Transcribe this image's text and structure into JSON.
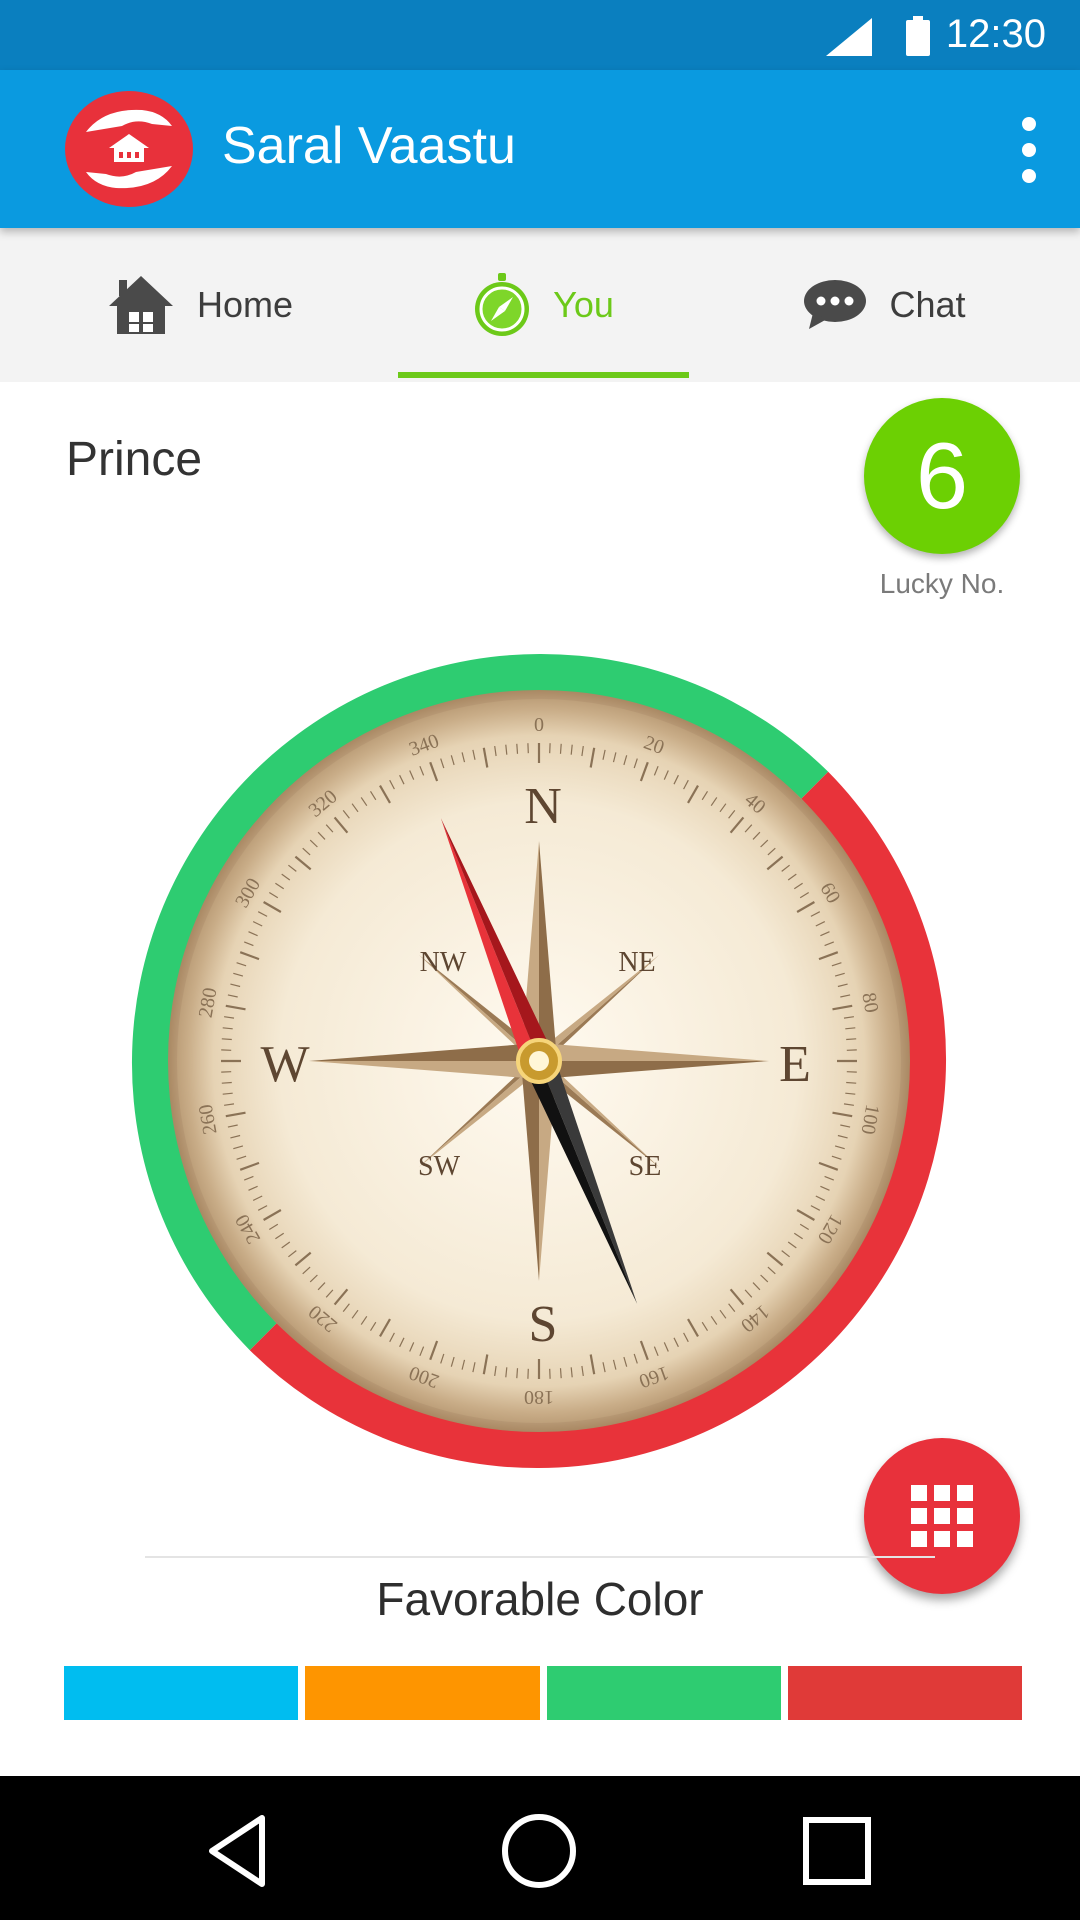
{
  "status_bar": {
    "time": "12:30"
  },
  "app_bar": {
    "title": "Saral Vaastu",
    "brand_color": "#0a9ae0"
  },
  "tabs": [
    {
      "label": "Home",
      "icon": "house-icon",
      "active": false
    },
    {
      "label": "You",
      "icon": "compass-icon",
      "active": true
    },
    {
      "label": "Chat",
      "icon": "chat-bubble-icon",
      "active": false
    }
  ],
  "profile": {
    "name": "Prince",
    "lucky_number": "6",
    "lucky_label": "Lucky No."
  },
  "compass": {
    "cardinals": [
      "N",
      "E",
      "S",
      "W"
    ],
    "intercardinals": [
      "NE",
      "SE",
      "SW",
      "NW"
    ],
    "degree_labels": [
      "0",
      "20",
      "40",
      "60",
      "80",
      "100",
      "120",
      "140",
      "160",
      "180",
      "200",
      "220",
      "240",
      "260",
      "280",
      "300",
      "320",
      "340"
    ],
    "favorable_arc_color": "#2ecc71",
    "unfavorable_arc_color": "#e8333a"
  },
  "favorable_color": {
    "title": "Favorable Color",
    "swatches": [
      "#00bdf0",
      "#fe9500",
      "#2ecc71",
      "#e03a38"
    ]
  },
  "fab": {
    "icon": "grid-icon"
  }
}
